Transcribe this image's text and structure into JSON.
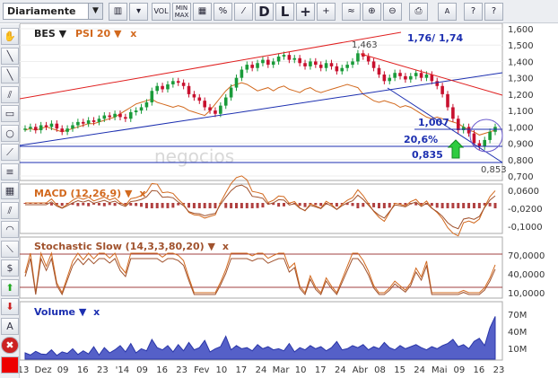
{
  "toolbar": {
    "period": "Diariamente",
    "vol": "VOL",
    "minmax_top": "MIN",
    "minmax_bottom": "MAX",
    "pct": "%",
    "d": "D",
    "l": "L",
    "plus": "+",
    "aa": "A"
  },
  "icons": [
    "hand-icon",
    "line-tool-icon",
    "diagonal-line-icon",
    "parallel-line-icon",
    "rectangle-icon",
    "circle-icon",
    "fan-icon",
    "fibonacci-icon",
    "grid-icon",
    "channel-icon",
    "arc-icon",
    "trend-icon",
    "dollar-icon",
    "arrow-up-icon",
    "arrow-down-icon",
    "text-icon",
    "delete-icon",
    "color-swatch-icon"
  ],
  "main_legend": {
    "symbol": "BES",
    "indicator": "PSI 20",
    "close": "x"
  },
  "annotations": {
    "top_high": "1,463",
    "fib_ratio": "1,76/ 1,74",
    "level_1007": "1,007",
    "level_pct": "20,6%",
    "level_0835": "0,835",
    "low": "0,853",
    "watermark": "negocios"
  },
  "price_axis": [
    "1,600",
    "1,500",
    "1,400",
    "1,300",
    "1,200",
    "1,100",
    "1,000",
    "0,900",
    "0,800",
    "0,700"
  ],
  "macd": {
    "label": "MACD (12,26,9)",
    "close": "x",
    "axis": [
      "0,0600",
      "-0,0200",
      "-0,1000"
    ]
  },
  "stoch": {
    "label": "Stochastic Slow (14,3,3,80,20)",
    "close": "x",
    "axis": [
      "70,0000",
      "40,0000",
      "10,0000"
    ]
  },
  "volume": {
    "label": "Volume",
    "close": "x",
    "axis": [
      "70M",
      "40M",
      "10M"
    ]
  },
  "x_axis": [
    "13",
    "Dez",
    "09",
    "16",
    "23",
    "'14",
    "09",
    "16",
    "23",
    "Fev",
    "10",
    "17",
    "24",
    "Mar",
    "10",
    "17",
    "24",
    "Abr",
    "08",
    "15",
    "24",
    "Mai",
    "09",
    "16",
    "23"
  ],
  "colors": {
    "price_up": "#1a9b3a",
    "price_down": "#c8102e",
    "psi": "#d2691e",
    "trend_red": "#e02020",
    "trend_blue": "#1c2fb0",
    "volume": "#5560c8"
  },
  "chart_data": {
    "type": "candlestick",
    "y_range": [
      0.7,
      1.6
    ],
    "closes": [
      0.99,
      1.0,
      0.98,
      1.01,
      1.0,
      1.02,
      0.99,
      0.97,
      0.99,
      1.01,
      1.03,
      1.02,
      1.04,
      1.03,
      1.05,
      1.07,
      1.06,
      1.08,
      1.06,
      1.05,
      1.09,
      1.1,
      1.12,
      1.15,
      1.22,
      1.25,
      1.23,
      1.26,
      1.28,
      1.27,
      1.25,
      1.2,
      1.18,
      1.16,
      1.12,
      1.1,
      1.08,
      1.13,
      1.18,
      1.24,
      1.3,
      1.35,
      1.38,
      1.36,
      1.39,
      1.41,
      1.38,
      1.4,
      1.43,
      1.44,
      1.41,
      1.42,
      1.39,
      1.37,
      1.4,
      1.38,
      1.36,
      1.39,
      1.37,
      1.34,
      1.36,
      1.38,
      1.4,
      1.45,
      1.43,
      1.4,
      1.36,
      1.32,
      1.28,
      1.3,
      1.33,
      1.31,
      1.29,
      1.31,
      1.33,
      1.3,
      1.32,
      1.28,
      1.25,
      1.2,
      1.12,
      1.05,
      0.98,
      1.0,
      0.96,
      0.9,
      0.88,
      0.92,
      0.97,
      1.0
    ],
    "psi20": [
      0.98,
      0.99,
      0.98,
      0.99,
      1.0,
      0.99,
      0.98,
      0.97,
      0.98,
      0.99,
      1.0,
      1.01,
      1.02,
      1.02,
      1.03,
      1.04,
      1.05,
      1.06,
      1.08,
      1.1,
      1.12,
      1.14,
      1.15,
      1.16,
      1.17,
      1.15,
      1.14,
      1.13,
      1.12,
      1.13,
      1.12,
      1.1,
      1.09,
      1.08,
      1.07,
      1.1,
      1.14,
      1.18,
      1.22,
      1.25,
      1.26,
      1.27,
      1.26,
      1.24,
      1.22,
      1.23,
      1.24,
      1.22,
      1.24,
      1.25,
      1.23,
      1.22,
      1.21,
      1.23,
      1.24,
      1.22,
      1.21,
      1.22,
      1.23,
      1.24,
      1.25,
      1.26,
      1.25,
      1.24,
      1.2,
      1.18,
      1.16,
      1.15,
      1.16,
      1.15,
      1.14,
      1.12,
      1.13,
      1.12,
      1.1,
      1.08,
      1.06,
      1.05,
      1.06,
      1.05,
      1.04,
      1.03,
      1.02,
      1.0,
      0.98,
      0.97,
      0.95,
      0.96,
      0.97,
      0.98
    ],
    "volume": [
      12,
      8,
      15,
      10,
      9,
      18,
      7,
      14,
      11,
      20,
      9,
      16,
      10,
      24,
      8,
      22,
      12,
      18,
      26,
      14,
      30,
      12,
      20,
      16,
      38,
      22,
      18,
      26,
      14,
      28,
      16,
      32,
      18,
      22,
      36,
      14,
      20,
      24,
      44,
      18,
      26,
      20,
      22,
      16,
      28,
      20,
      24,
      18,
      20,
      16,
      30,
      14,
      22,
      18,
      26,
      20,
      24,
      16,
      22,
      34,
      18,
      20,
      26,
      22,
      28,
      18,
      24,
      20,
      32,
      22,
      18,
      26,
      20,
      24,
      28,
      22,
      18,
      24,
      20,
      26,
      30,
      38,
      24,
      28,
      20,
      34,
      40,
      26,
      60,
      82
    ]
  }
}
